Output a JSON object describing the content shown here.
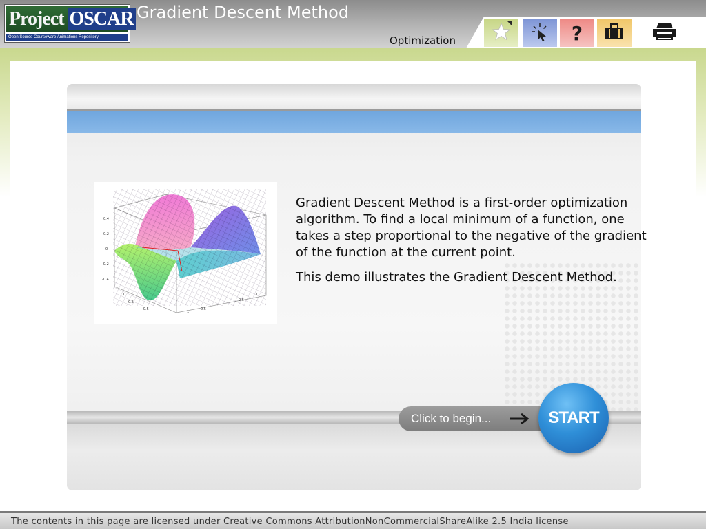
{
  "header": {
    "logo": {
      "project": "Project",
      "oscar": "OSCAR",
      "tagline": "Open Source Courseware Animations Repository"
    },
    "title": "Gradient Descent Method",
    "section": "Optimization",
    "tools": [
      {
        "name": "star-icon",
        "color": "#c7d686"
      },
      {
        "name": "cursor-icon",
        "color": "#7e95d6"
      },
      {
        "name": "help-icon",
        "label": "?",
        "color": "#ee8a86"
      },
      {
        "name": "briefcase-icon",
        "color": "#f1c769"
      },
      {
        "name": "printer-icon"
      }
    ]
  },
  "content": {
    "paragraph1": "Gradient Descent Method is a first-order optimization algorithm. To find a local minimum of a function, one takes a step proportional to the negative of the gradient of the function at the current point.",
    "paragraph2": "This demo illustrates the Gradient Descent Method.",
    "begin_label": "Click to begin...",
    "start_label": "START"
  },
  "footer": {
    "license": "The contents in this page are licensed under Creative Commons AttributionNonCommercialShareAlike 2.5 India license"
  },
  "colors": {
    "accent_blue": "#70a6de",
    "green_band": "#c9d88e",
    "start_button": "#2f8fd8"
  }
}
